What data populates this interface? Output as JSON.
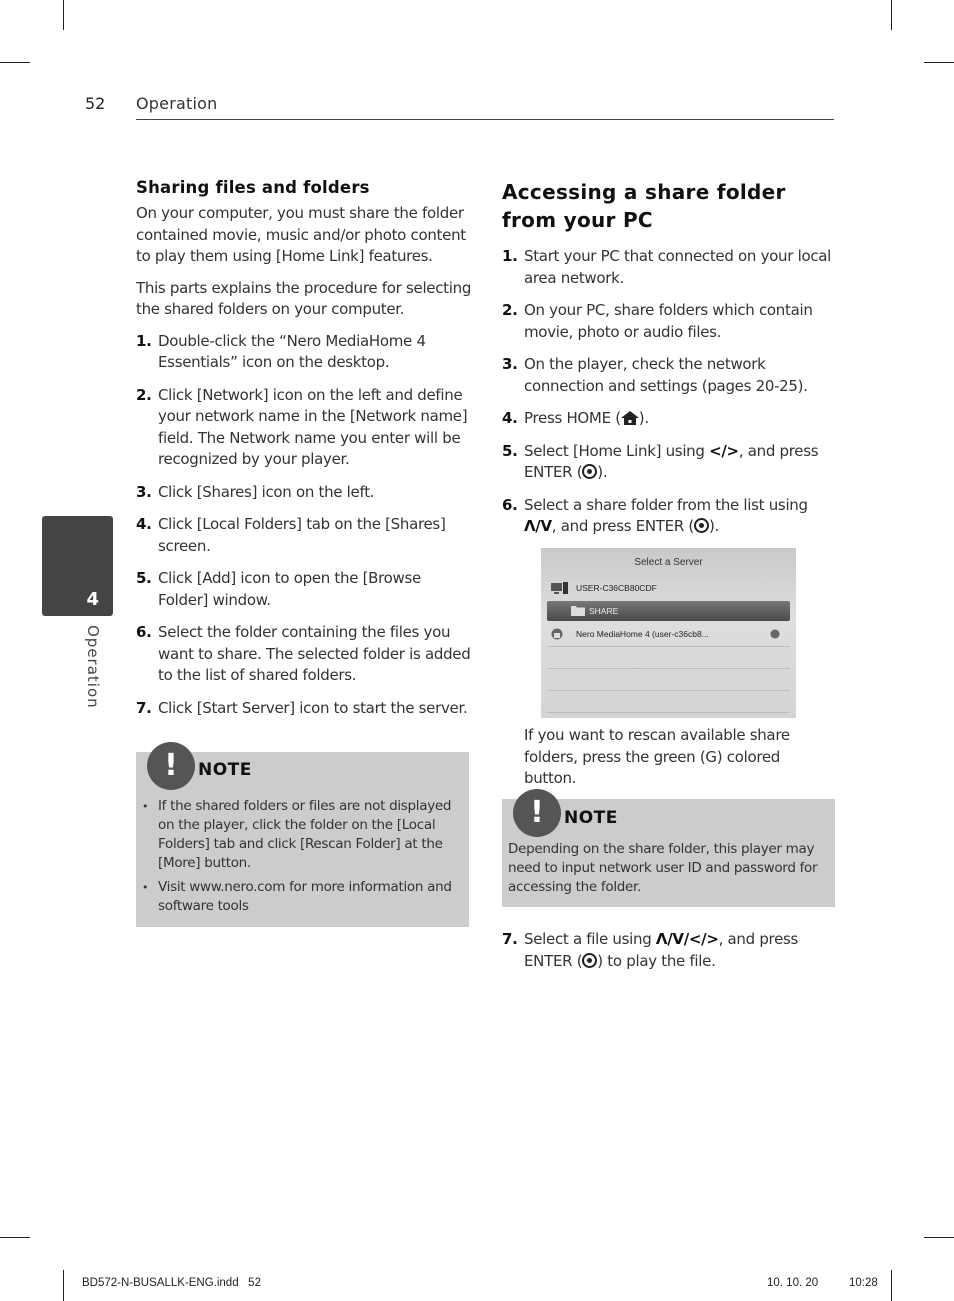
{
  "header": {
    "page_number": "52",
    "running_title": "Operation"
  },
  "side_tab": {
    "chapter_number": "4",
    "chapter_label": "Operation"
  },
  "left_column": {
    "heading": "Sharing files and folders",
    "paragraphs": [
      "On your computer, you must share the folder contained movie, music and/or photo content to play them using [Home Link] features.",
      "This parts explains the procedure for selecting the shared folders on your computer."
    ],
    "steps": [
      {
        "num": "1.",
        "text": "Double-click the “Nero MediaHome 4 Essentials” icon on the desktop."
      },
      {
        "num": "2.",
        "text": "Click [Network] icon on the left and define your network name in the [Network name] field. The Network name you enter will be recognized by your player."
      },
      {
        "num": "3.",
        "text": "Click [Shares] icon on the left."
      },
      {
        "num": "4.",
        "text": "Click [Local Folders] tab on the [Shares] screen."
      },
      {
        "num": "5.",
        "text": "Click [Add] icon to open the [Browse Folder] window."
      },
      {
        "num": "6.",
        "text": "Select the folder containing the files you want to share. The selected folder is added to the list of shared folders."
      },
      {
        "num": "7.",
        "text": "Click [Start Server] icon to start the server."
      }
    ],
    "note": {
      "title": "NOTE",
      "bullets": [
        "If the shared folders or files are not displayed on the player, click the folder on the [Local Folders] tab and click [Rescan Folder] at the [More] button.",
        "Visit www.nero.com for more information and software tools"
      ]
    }
  },
  "right_column": {
    "heading": "Accessing a share folder from your PC",
    "steps": [
      {
        "num": "1.",
        "text": "Start your PC that connected on your local area network."
      },
      {
        "num": "2.",
        "text": "On your PC, share folders which contain movie, photo or audio files."
      },
      {
        "num": "3.",
        "text": "On the player, check the network connection and settings (pages 20-25)."
      },
      {
        "num": "4.",
        "pre": "Press HOME (",
        "post": ")."
      },
      {
        "num": "5.",
        "pre": "Select [Home Link] using ",
        "arrows": "</>",
        "mid": ", and press ENTER (",
        "post": ")."
      },
      {
        "num": "6.",
        "pre": "Select a share folder from the list using ",
        "arrows": "Λ/V",
        "mid": ", and press ENTER (",
        "post": ")."
      }
    ],
    "screen": {
      "title": "Select a Server",
      "server_name": "USER-C36CB80CDF",
      "selected_item": "SHARE",
      "second_server": "Nero MediaHome 4 (user-c36cb8..."
    },
    "rescan_text": "If you want to rescan available share folders, press the green (G) colored button.",
    "note": {
      "title": "NOTE",
      "body": "Depending on the share folder, this player may need to input network user ID and password for accessing the folder."
    },
    "step7": {
      "num": "7.",
      "pre": "Select a file using ",
      "arrows": "Λ/V/</>",
      "mid": ", and press ENTER (",
      "post": ") to play the file."
    }
  },
  "footer": {
    "file": "BD572-N-BUSALLK-ENG.indd   52",
    "date": "10. 10. 20",
    "time": "10:28"
  }
}
